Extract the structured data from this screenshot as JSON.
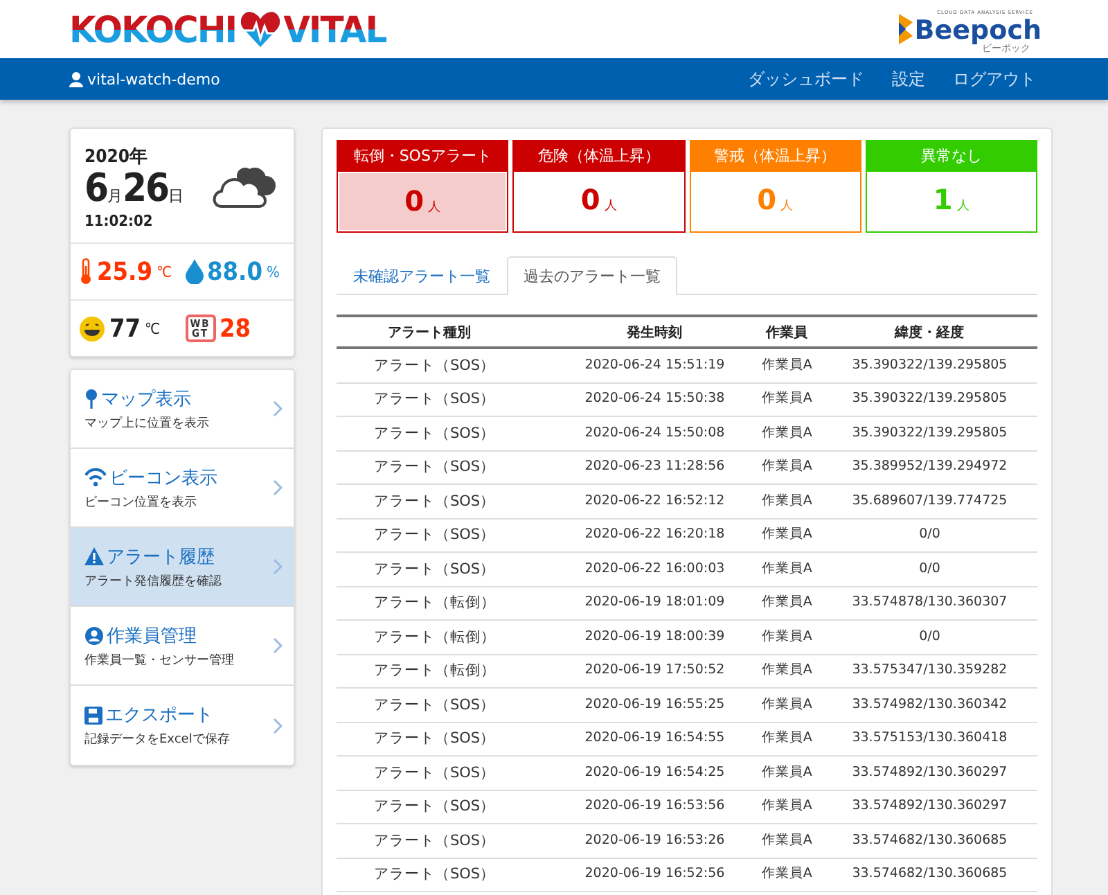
{
  "header": {
    "logo_left": "KOKOCHI",
    "logo_right": "VITAL",
    "brand_tagline": "CLOUD DATA ANALYSIS SERVICE",
    "brand_name": "Beepoch",
    "brand_kana": "ビーポック"
  },
  "nav": {
    "user": "vital-watch-demo",
    "links": [
      {
        "label": "ダッシュボード"
      },
      {
        "label": "設定"
      },
      {
        "label": "ログアウト"
      }
    ]
  },
  "weather": {
    "year": "2020年",
    "month": "6",
    "month_unit": "月",
    "day": "26",
    "day_unit": "日",
    "time": "11:02:02",
    "temperature": "25.9",
    "temperature_unit": "℃",
    "humidity": "88.0",
    "humidity_unit": "%",
    "heat_index": "77",
    "heat_index_unit": "℃",
    "wbgt_label": "WBGT",
    "wbgt": "28"
  },
  "menu": [
    {
      "kind": "pin",
      "title": "マップ表示",
      "subtitle": "マップ上に位置を表示",
      "selected": false
    },
    {
      "kind": "wifi",
      "title": "ビーコン表示",
      "subtitle": "ビーコン位置を表示",
      "selected": false
    },
    {
      "kind": "warning",
      "title": "アラート履歴",
      "subtitle": "アラート発信履歴を確認",
      "selected": true
    },
    {
      "kind": "user",
      "title": "作業員管理",
      "subtitle": "作業員一覧・センサー管理",
      "selected": false
    },
    {
      "kind": "save",
      "title": "エクスポート",
      "subtitle": "記録データをExcelで保存",
      "selected": false
    }
  ],
  "status_cards": [
    {
      "label": "転倒・SOSアラート",
      "count": "0",
      "unit": "人",
      "color": "#cc0000",
      "selected": true
    },
    {
      "label": "危険（体温上昇）",
      "count": "0",
      "unit": "人",
      "color": "#cc0000",
      "selected": false
    },
    {
      "label": "警戒（体温上昇）",
      "count": "0",
      "unit": "人",
      "color": "#ff8000",
      "selected": false
    },
    {
      "label": "異常なし",
      "count": "1",
      "unit": "人",
      "color": "#33cc00",
      "selected": false
    }
  ],
  "tabs": [
    {
      "label": "未確認アラート一覧",
      "selected": false
    },
    {
      "label": "過去のアラート一覧",
      "selected": true
    }
  ],
  "table": {
    "columns": [
      "アラート種別",
      "発生時刻",
      "作業員",
      "緯度・経度"
    ],
    "rows": [
      [
        "アラート（SOS）",
        "2020-06-24 15:51:19",
        "作業員A",
        "35.390322/139.295805"
      ],
      [
        "アラート（SOS）",
        "2020-06-24 15:50:38",
        "作業員A",
        "35.390322/139.295805"
      ],
      [
        "アラート（SOS）",
        "2020-06-24 15:50:08",
        "作業員A",
        "35.390322/139.295805"
      ],
      [
        "アラート（SOS）",
        "2020-06-23 11:28:56",
        "作業員A",
        "35.389952/139.294972"
      ],
      [
        "アラート（SOS）",
        "2020-06-22 16:52:12",
        "作業員A",
        "35.689607/139.774725"
      ],
      [
        "アラート（SOS）",
        "2020-06-22 16:20:18",
        "作業員A",
        "0/0"
      ],
      [
        "アラート（SOS）",
        "2020-06-22 16:00:03",
        "作業員A",
        "0/0"
      ],
      [
        "アラート（転倒）",
        "2020-06-19 18:01:09",
        "作業員A",
        "33.574878/130.360307"
      ],
      [
        "アラート（転倒）",
        "2020-06-19 18:00:39",
        "作業員A",
        "0/0"
      ],
      [
        "アラート（転倒）",
        "2020-06-19 17:50:52",
        "作業員A",
        "33.575347/130.359282"
      ],
      [
        "アラート（SOS）",
        "2020-06-19 16:55:25",
        "作業員A",
        "33.574982/130.360342"
      ],
      [
        "アラート（SOS）",
        "2020-06-19 16:54:55",
        "作業員A",
        "33.575153/130.360418"
      ],
      [
        "アラート（SOS）",
        "2020-06-19 16:54:25",
        "作業員A",
        "33.574892/130.360297"
      ],
      [
        "アラート（SOS）",
        "2020-06-19 16:53:56",
        "作業員A",
        "33.574892/130.360297"
      ],
      [
        "アラート（SOS）",
        "2020-06-19 16:53:26",
        "作業員A",
        "33.574682/130.360685"
      ],
      [
        "アラート（SOS）",
        "2020-06-19 16:52:56",
        "作業員A",
        "33.574682/130.360685"
      ]
    ]
  }
}
